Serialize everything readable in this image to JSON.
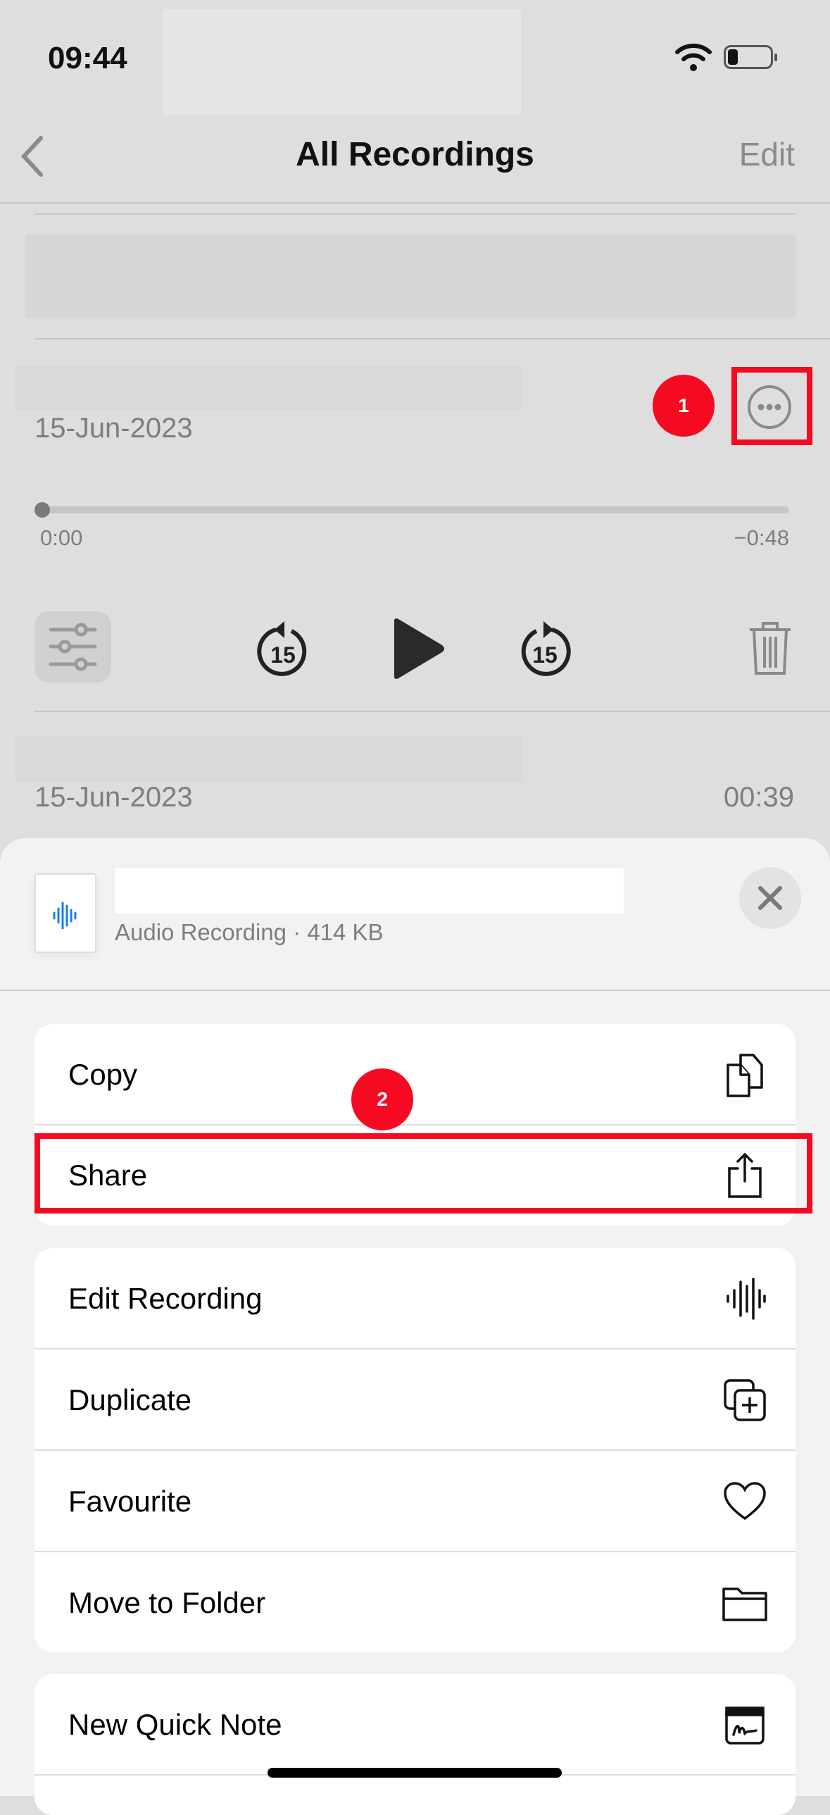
{
  "status_bar": {
    "time": "09:44",
    "icons": [
      "wifi-icon",
      "battery-low-icon"
    ]
  },
  "nav": {
    "back_icon": "chevron-left-icon",
    "title": "All Recordings",
    "edit_label": "Edit"
  },
  "recordings": [
    {
      "date": "15-Jun-2023",
      "elapsed": "0:00",
      "remaining": "−0:48",
      "progress": 0
    },
    {
      "date": "15-Jun-2023",
      "duration": "00:39"
    }
  ],
  "player": {
    "icons": [
      "sliders-icon",
      "skip-back-15-icon",
      "play-icon",
      "skip-forward-15-icon",
      "trash-icon"
    ],
    "skip_label": "15"
  },
  "sheet": {
    "subtitle": "Audio Recording · 414 KB",
    "close_icon": "close-icon"
  },
  "menu_groups": [
    [
      {
        "label": "Copy",
        "icon": "copy-icon"
      },
      {
        "label": "Share",
        "icon": "share-icon"
      }
    ],
    [
      {
        "label": "Edit Recording",
        "icon": "waveform-icon"
      },
      {
        "label": "Duplicate",
        "icon": "duplicate-icon"
      },
      {
        "label": "Favourite",
        "icon": "heart-icon"
      },
      {
        "label": "Move to Folder",
        "icon": "folder-icon"
      }
    ],
    [
      {
        "label": "New Quick Note",
        "icon": "quick-note-icon"
      }
    ]
  ],
  "annotations": {
    "step1": "1",
    "step2": "2",
    "highlight_color": "#f50a22"
  }
}
